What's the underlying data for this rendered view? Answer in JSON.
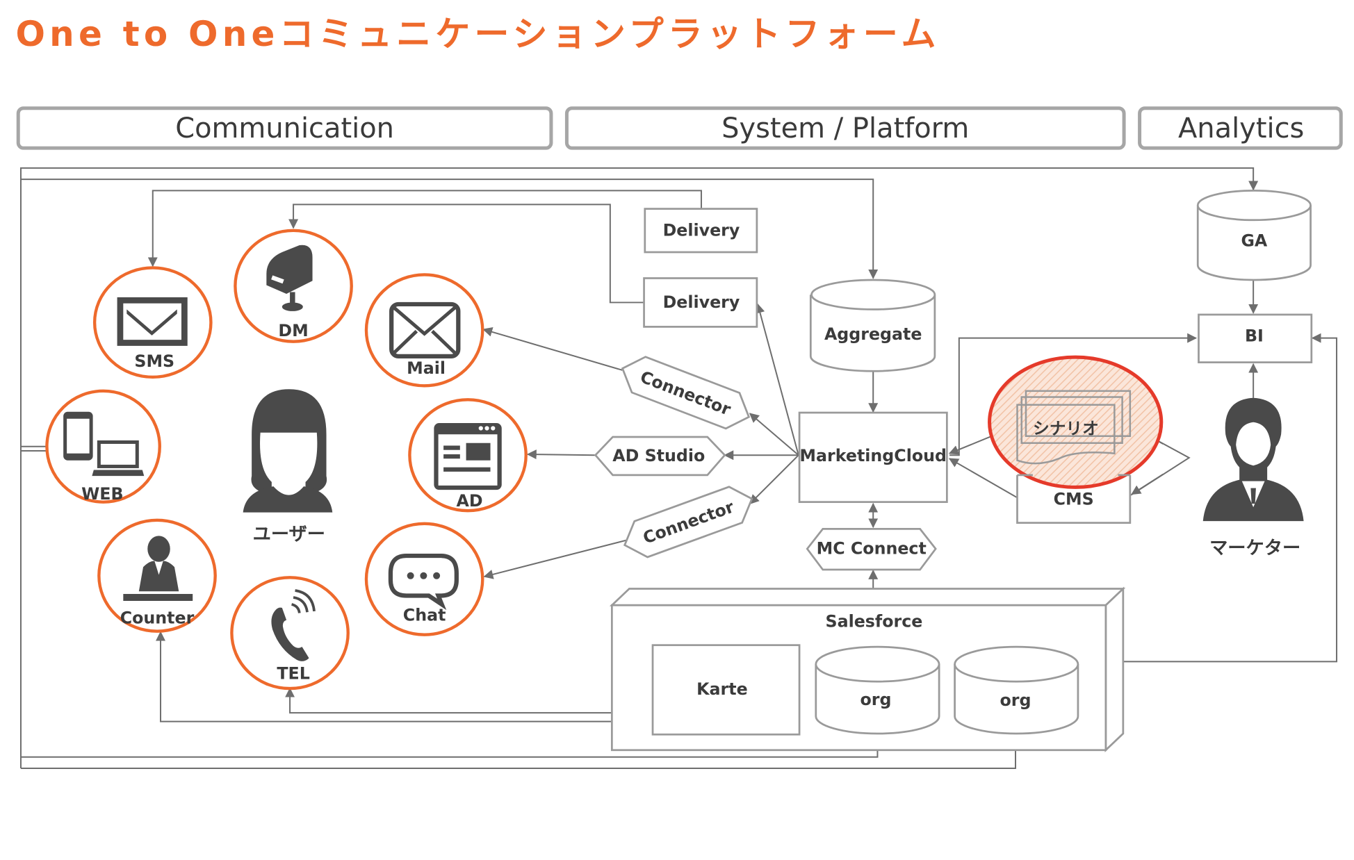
{
  "title": "One to Oneコミュニケーションプラットフォーム",
  "colors": {
    "accent": "#ee6a2c",
    "highlight_ring": "#e53a2a",
    "line": "#6e6e6e",
    "box_border": "#9a9a9a",
    "icon": "#4a4a4a"
  },
  "sections": {
    "communication": "Communication",
    "system_platform": "System / Platform",
    "analytics": "Analytics"
  },
  "channels": {
    "sms": {
      "label": "SMS",
      "icon": "sms-envelope-icon"
    },
    "dm": {
      "label": "DM",
      "icon": "mailbox-icon"
    },
    "mail": {
      "label": "Mail",
      "icon": "envelope-icon"
    },
    "web": {
      "label": "WEB",
      "icon": "devices-icon"
    },
    "ad": {
      "label": "AD",
      "icon": "browser-ad-icon"
    },
    "counter": {
      "label": "Counter",
      "icon": "receptionist-icon"
    },
    "tel": {
      "label": "TEL",
      "icon": "phone-icon"
    },
    "chat": {
      "label": "Chat",
      "icon": "chat-bubble-icon"
    }
  },
  "actors": {
    "user": "ユーザー",
    "marketer": "マーケター"
  },
  "system": {
    "delivery_1": "Delivery",
    "delivery_2": "Delivery",
    "aggregate": "Aggregate",
    "connector_top": "Connector",
    "ad_studio": "AD Studio",
    "connector_bottom": "Connector",
    "marketing_cloud": "MarketingCloud",
    "mc_connect": "MC Connect",
    "salesforce": "Salesforce",
    "karte": "Karte",
    "org_1": "org",
    "org_2": "org",
    "scenario": "シナリオ",
    "cms": "CMS"
  },
  "analytics": {
    "ga": "GA",
    "bi": "BI"
  }
}
